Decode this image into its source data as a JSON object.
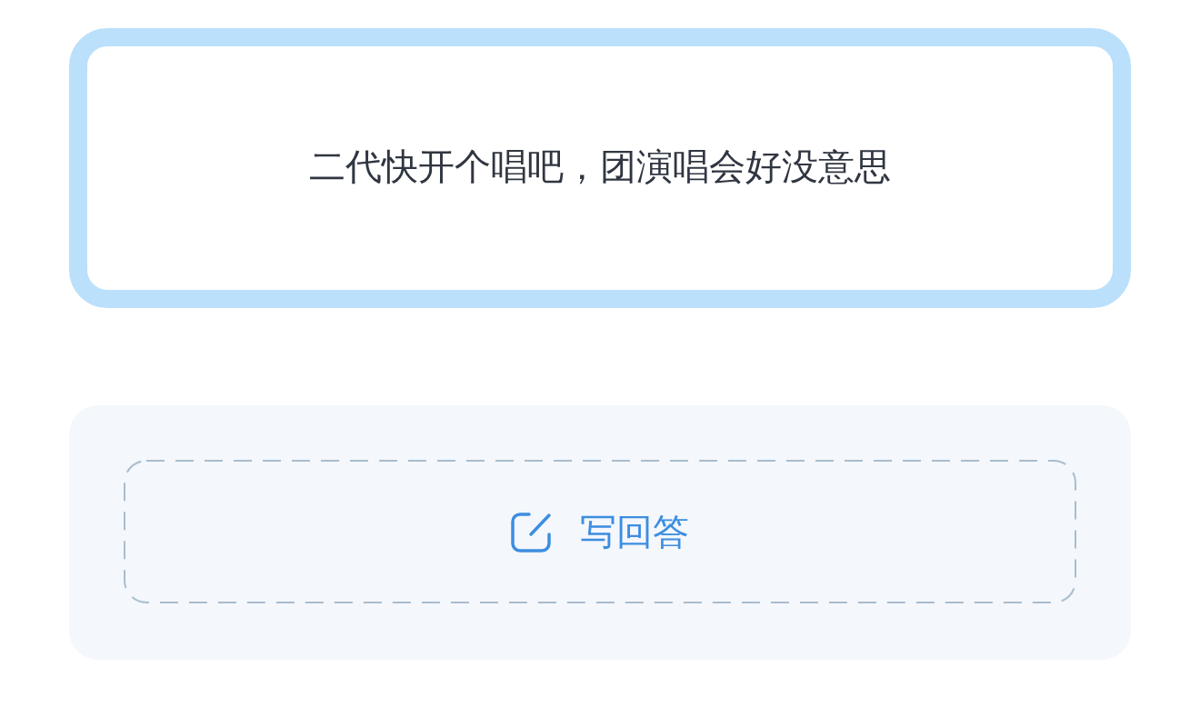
{
  "question": {
    "text": "二代快开个唱吧，团演唱会好没意思"
  },
  "answer_action": {
    "label": "写回答"
  }
}
